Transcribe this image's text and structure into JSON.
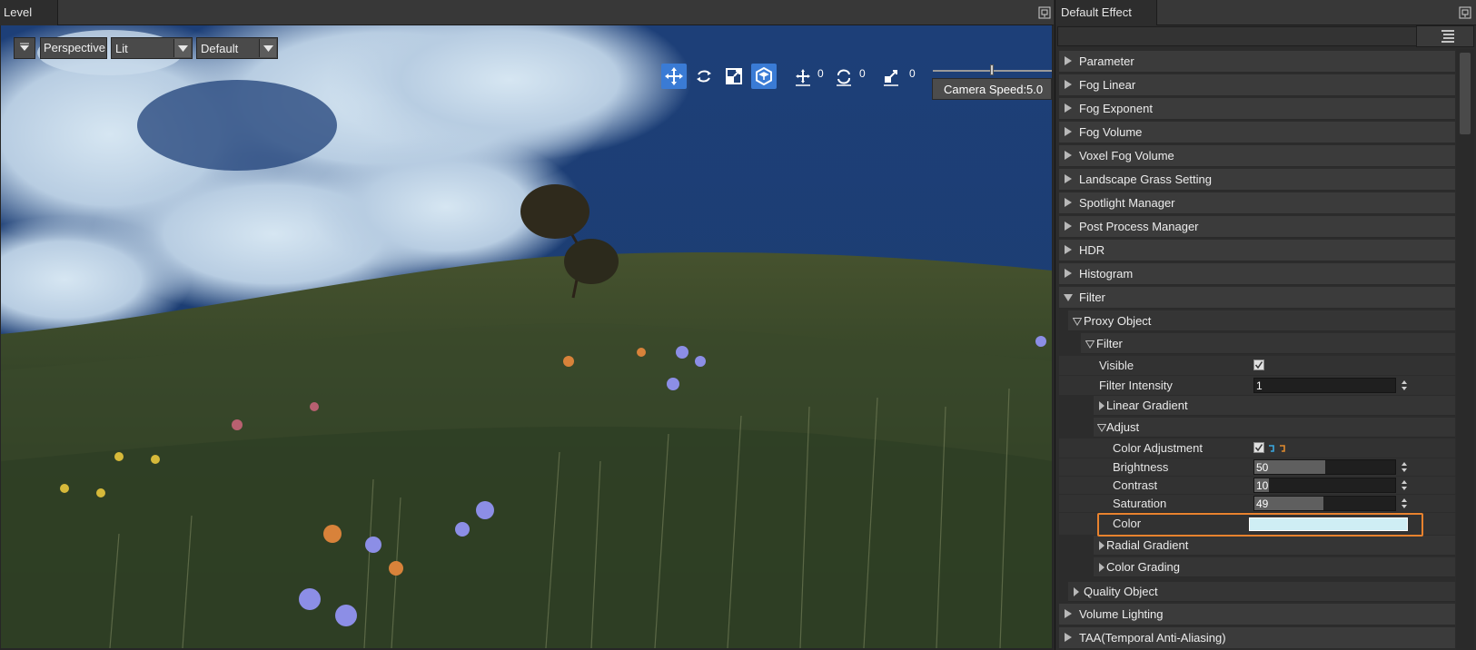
{
  "level_panel": {
    "tab_title": "Level",
    "toolbar": {
      "perspective_label": "Perspective",
      "lit_value": "Lit",
      "default_value": "Default",
      "translate_snap": "0",
      "rotate_snap": "0",
      "scale_snap": "0",
      "camera_speed": "Camera Speed:5.0"
    }
  },
  "effect_panel": {
    "tab_title": "Default Effect",
    "sections": [
      {
        "label": "Parameter",
        "expanded": false
      },
      {
        "label": "Fog Linear",
        "expanded": false
      },
      {
        "label": "Fog Exponent",
        "expanded": false
      },
      {
        "label": "Fog Volume",
        "expanded": false
      },
      {
        "label": "Voxel Fog Volume",
        "expanded": false
      },
      {
        "label": "Landscape Grass Setting",
        "expanded": false
      },
      {
        "label": "Spotlight Manager",
        "expanded": false
      },
      {
        "label": "Post Process Manager",
        "expanded": false
      },
      {
        "label": "HDR",
        "expanded": false
      },
      {
        "label": "Histogram",
        "expanded": false
      },
      {
        "label": "Filter",
        "expanded": true
      }
    ],
    "filter": {
      "proxy_object": "Proxy Object",
      "filter_group": "Filter",
      "visible_label": "Visible",
      "filter_intensity_label": "Filter Intensity",
      "filter_intensity_value": "1",
      "linear_gradient": "Linear Gradient",
      "adjust": "Adjust",
      "color_adjustment_label": "Color Adjustment",
      "brightness_label": "Brightness",
      "brightness_value": "50",
      "contrast_label": "Contrast",
      "contrast_value": "10",
      "saturation_label": "Saturation",
      "saturation_value": "49",
      "color_label": "Color",
      "color_value": "#cfeef4",
      "radial_gradient": "Radial Gradient",
      "color_grading": "Color Grading",
      "quality_object": "Quality Object"
    },
    "trailing_sections": [
      {
        "label": "Volume Lighting"
      },
      {
        "label": "TAA(Temporal Anti-Aliasing)"
      }
    ]
  },
  "colors": {
    "accent_blue": "#3a7bd5",
    "highlight_orange": "#e8822e",
    "link_icon_blue": "#3aa7e0",
    "link_icon_orange": "#e08a2e"
  }
}
